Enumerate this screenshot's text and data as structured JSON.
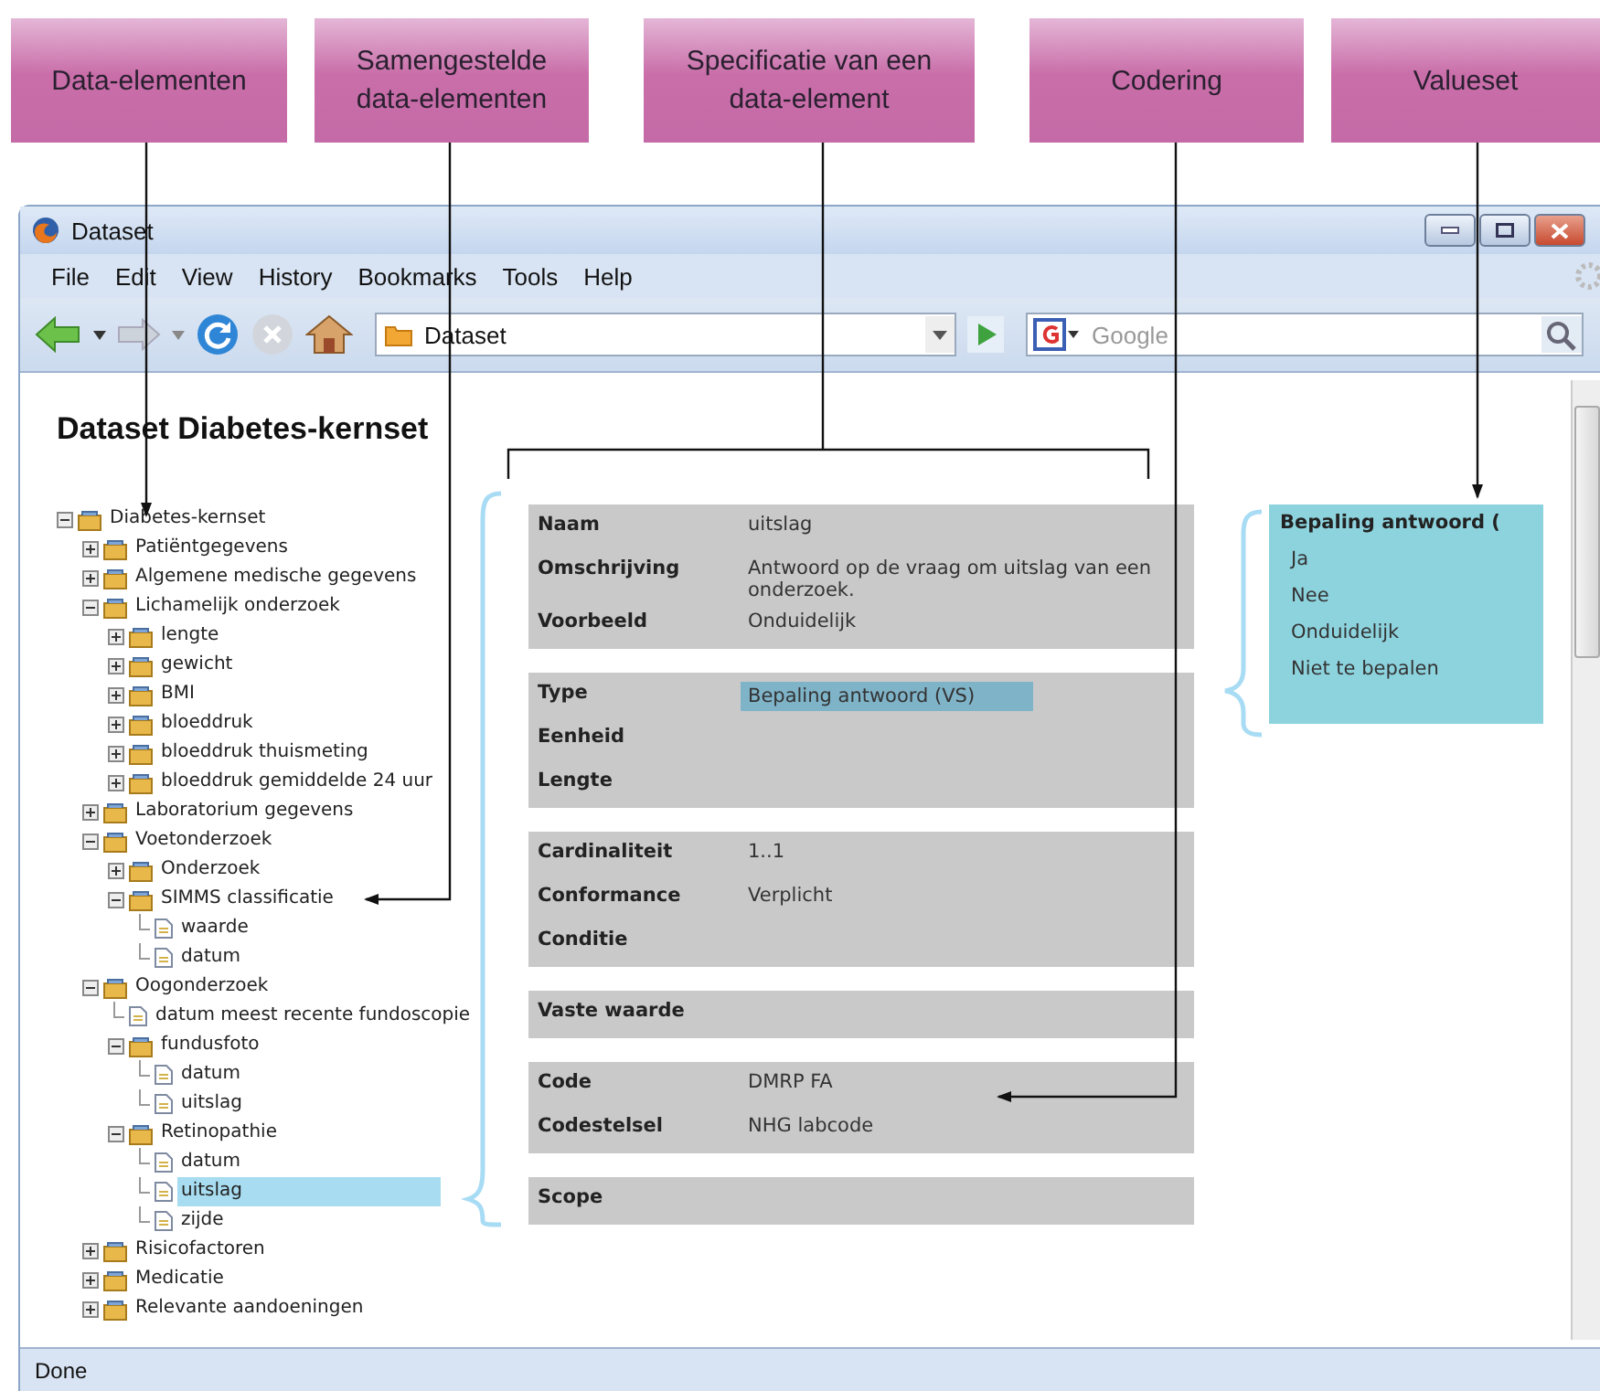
{
  "callouts": [
    "Data-elementen",
    "Samengestelde data-elementen",
    "Specificatie van een data-element",
    "Codering",
    "Valueset"
  ],
  "window": {
    "title": "Dataset"
  },
  "menu": [
    "File",
    "Edit",
    "View",
    "History",
    "Bookmarks",
    "Tools",
    "Help"
  ],
  "toolbar": {
    "address": "Dataset",
    "search_placeholder": "Google"
  },
  "page": {
    "heading": "Dataset Diabetes-kernset"
  },
  "tree": [
    {
      "label": "Diabetes-kernset",
      "kind": "folder",
      "expanded": true,
      "selected": false,
      "children": [
        {
          "label": "Patiëntgegevens",
          "kind": "folder",
          "expanded": false,
          "selected": false
        },
        {
          "label": "Algemene medische gegevens",
          "kind": "folder",
          "expanded": false,
          "selected": false
        },
        {
          "label": "Lichamelijk onderzoek",
          "kind": "folder",
          "expanded": true,
          "selected": false,
          "children": [
            {
              "label": "lengte",
              "kind": "folder",
              "expanded": false,
              "selected": false
            },
            {
              "label": "gewicht",
              "kind": "folder",
              "expanded": false,
              "selected": false
            },
            {
              "label": "BMI",
              "kind": "folder",
              "expanded": false,
              "selected": false
            },
            {
              "label": "bloeddruk",
              "kind": "folder",
              "expanded": false,
              "selected": false
            },
            {
              "label": "bloeddruk thuismeting",
              "kind": "folder",
              "expanded": false,
              "selected": false
            },
            {
              "label": "bloeddruk gemiddelde 24 uur",
              "kind": "folder",
              "expanded": false,
              "selected": false
            }
          ]
        },
        {
          "label": "Laboratorium gegevens",
          "kind": "folder",
          "expanded": false,
          "selected": false
        },
        {
          "label": "Voetonderzoek",
          "kind": "folder",
          "expanded": true,
          "selected": false,
          "children": [
            {
              "label": "Onderzoek",
              "kind": "folder",
              "expanded": false,
              "selected": false
            },
            {
              "label": "SIMMS classificatie",
              "kind": "folder",
              "expanded": true,
              "selected": false,
              "children": [
                {
                  "label": "waarde",
                  "kind": "file",
                  "selected": false
                },
                {
                  "label": "datum",
                  "kind": "file",
                  "selected": false
                }
              ]
            }
          ]
        },
        {
          "label": "Oogonderzoek",
          "kind": "folder",
          "expanded": true,
          "selected": false,
          "children": [
            {
              "label": "datum meest recente fundoscopie",
              "kind": "file",
              "selected": false
            },
            {
              "label": "fundusfoto",
              "kind": "folder",
              "expanded": true,
              "selected": false,
              "children": [
                {
                  "label": "datum",
                  "kind": "file",
                  "selected": false
                },
                {
                  "label": "uitslag",
                  "kind": "file",
                  "selected": false
                }
              ]
            },
            {
              "label": "Retinopathie",
              "kind": "folder",
              "expanded": true,
              "selected": false,
              "children": [
                {
                  "label": "datum",
                  "kind": "file",
                  "selected": false
                },
                {
                  "label": "uitslag",
                  "kind": "file",
                  "selected": true
                },
                {
                  "label": "zijde",
                  "kind": "file",
                  "selected": false
                }
              ]
            }
          ]
        },
        {
          "label": "Risicofactoren",
          "kind": "folder",
          "expanded": false,
          "selected": false
        },
        {
          "label": "Medicatie",
          "kind": "folder",
          "expanded": false,
          "selected": false
        },
        {
          "label": "Relevante aandoeningen",
          "kind": "folder",
          "expanded": false,
          "selected": false
        }
      ]
    }
  ],
  "details": [
    [
      {
        "label": "Naam",
        "value": "uitslag"
      },
      {
        "label": "Omschrijving",
        "value": "Antwoord op de vraag om uitslag van een onderzoek."
      },
      {
        "label": "Voorbeeld",
        "value": "Onduidelijk"
      }
    ],
    [
      {
        "label": "Type",
        "value": "Bepaling antwoord (VS)",
        "highlighted": true
      },
      {
        "label": "Eenheid"
      },
      {
        "label": "Lengte"
      }
    ],
    [
      {
        "label": "Cardinaliteit",
        "value": "1..1"
      },
      {
        "label": "Conformance",
        "value": "Verplicht"
      },
      {
        "label": "Conditie"
      }
    ],
    [
      {
        "label": "Vaste waarde"
      }
    ],
    [
      {
        "label": "Code",
        "value": "DMRP FA"
      },
      {
        "label": "Codestelsel",
        "value": "NHG labcode"
      }
    ],
    [
      {
        "label": "Scope"
      }
    ]
  ],
  "valueset": {
    "title": "Bepaling antwoord (",
    "items": [
      "Ja",
      "Nee",
      "Onduidelijk",
      "Niet te bepalen"
    ]
  },
  "status_bar": "Done"
}
